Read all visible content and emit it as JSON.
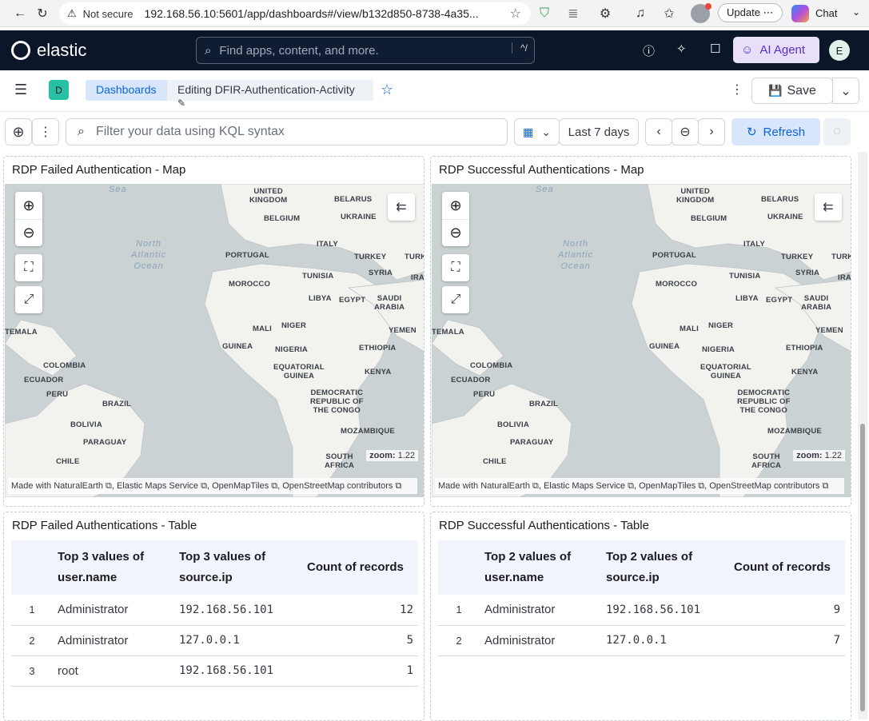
{
  "browser": {
    "security_label": "Not secure",
    "url": "192.168.56.10:5601/app/dashboards#/view/b132d850-8738-4a35...",
    "update_label": "Update",
    "chat_label": "Chat"
  },
  "kibana": {
    "logo_text": "elastic",
    "search_placeholder": "Find apps, content, and more.",
    "search_shortcut": "^/",
    "ai_agent_label": "AI Agent",
    "avatar_initial": "E",
    "space_initial": "D"
  },
  "breadcrumbs": [
    "Dashboards",
    "Editing DFIR-Authentication-Activity"
  ],
  "toolbar": {
    "save_label": "Save"
  },
  "query": {
    "placeholder": "Filter your data using KQL syntax",
    "time_range": "Last 7 days",
    "refresh_label": "Refresh"
  },
  "map_labels": {
    "sea": "Sea",
    "ocean": "North\nAtlantic\nOcean",
    "countries": [
      "UNITED\nKINGDOM",
      "BELARUS",
      "BELGIUM",
      "UKRAINE",
      "PORTUGAL",
      "ITALY",
      "TURKEY",
      "TURKI",
      "SYRIA",
      "IRA",
      "MOROCCO",
      "TUNISIA",
      "LIBYA",
      "EGYPT",
      "SAUDI\nARABIA",
      "YEMEN",
      "MALI",
      "NIGER",
      "TEMALA",
      "GUINEA",
      "NIGERIA",
      "ETHIOPIA",
      "COLOMBIA",
      "EQUATORIAL\nGUINEA",
      "KENYA",
      "ECUADOR",
      "PERU",
      "BRAZIL",
      "DEMOCRATIC\nREPUBLIC OF\nTHE CONGO",
      "BOLIVIA",
      "MOZAMBIQUE",
      "PARAGUAY",
      "SOUTH\nAFRICA",
      "CHILE"
    ]
  },
  "panels": {
    "failed_map": {
      "title": "RDP Failed Authentication - Map",
      "zoom_label": "zoom:",
      "zoom_value": "1.22",
      "attribution": "Made with NaturalEarth ⧉, Elastic Maps Service ⧉, OpenMapTiles ⧉, OpenStreetMap contributors ⧉"
    },
    "success_map": {
      "title": "RDP Successful Authentications - Map",
      "zoom_label": "zoom:",
      "zoom_value": "1.22",
      "attribution": "Made with NaturalEarth ⧉, Elastic Maps Service ⧉, OpenMapTiles ⧉, OpenStreetMap contributors ⧉"
    },
    "failed_table": {
      "title": "RDP Failed Authentications - Table",
      "columns": [
        "Top 3 values of user.name",
        "Top 3 values of source.ip",
        "Count of records"
      ],
      "rows": [
        {
          "n": "1",
          "user": "Administrator",
          "ip": "192.168.56.101",
          "count": "12"
        },
        {
          "n": "2",
          "user": "Administrator",
          "ip": "127.0.0.1",
          "count": "5"
        },
        {
          "n": "3",
          "user": "root",
          "ip": "192.168.56.101",
          "count": "1"
        }
      ]
    },
    "success_table": {
      "title": "RDP Successful Authentications - Table",
      "columns": [
        "Top 2 values of user.name",
        "Top 2 values of source.ip",
        "Count of records"
      ],
      "rows": [
        {
          "n": "1",
          "user": "Administrator",
          "ip": "192.168.56.101",
          "count": "9"
        },
        {
          "n": "2",
          "user": "Administrator",
          "ip": "127.0.0.1",
          "count": "7"
        }
      ]
    }
  }
}
